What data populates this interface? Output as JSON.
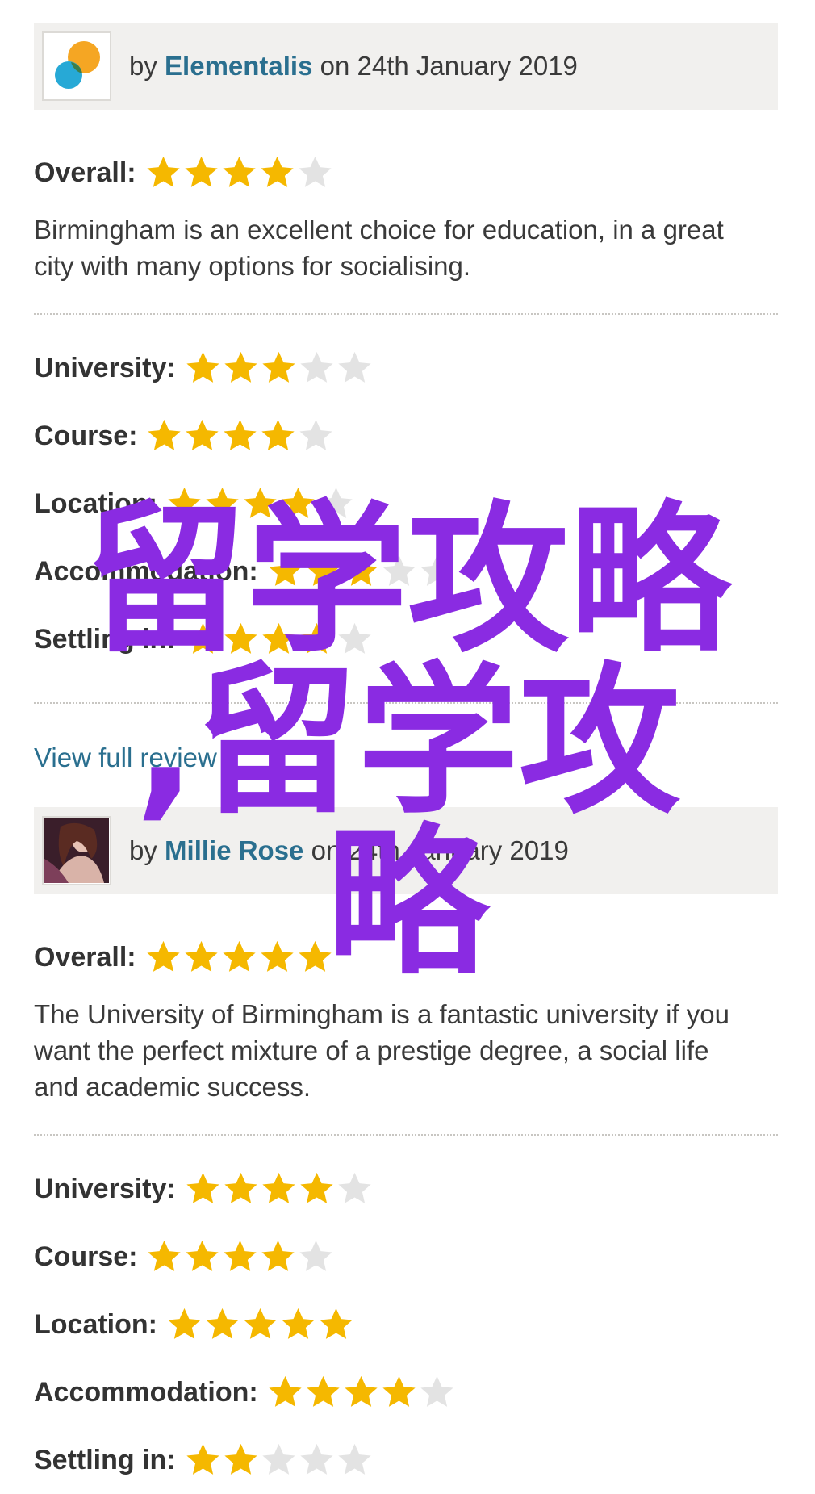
{
  "reviews": [
    {
      "by_prefix": "by",
      "author": "Elementalis",
      "date_text": "on 24th January 2019",
      "avatar_icon": "colored-bubbles-logo",
      "overall": {
        "label": "Overall:",
        "stars": 4,
        "max": 5
      },
      "summary": "Birmingham is an excellent choice for education, in a great city with many options for socialising.",
      "ratings": [
        {
          "label": "University:",
          "stars": 3,
          "max": 5
        },
        {
          "label": "Course:",
          "stars": 4,
          "max": 5
        },
        {
          "label": "Location:",
          "stars": 4,
          "max": 5
        },
        {
          "label": "Accommodation:",
          "stars": 3,
          "max": 5
        },
        {
          "label": "Settling in:",
          "stars": 4,
          "max": 5
        }
      ],
      "view_full_label": "View full review"
    },
    {
      "by_prefix": "by",
      "author": "Millie Rose",
      "date_text": "on 24th January 2019",
      "avatar_icon": "user-photo",
      "overall": {
        "label": "Overall:",
        "stars": 5,
        "max": 5
      },
      "summary": "The University of Birmingham is a fantastic university if you want the perfect mixture of a prestige degree, a social life and academic success.",
      "ratings": [
        {
          "label": "University:",
          "stars": 4,
          "max": 5
        },
        {
          "label": "Course:",
          "stars": 4,
          "max": 5
        },
        {
          "label": "Location:",
          "stars": 5,
          "max": 5
        },
        {
          "label": "Accommodation:",
          "stars": 4,
          "max": 5
        },
        {
          "label": "Settling in:",
          "stars": 2,
          "max": 5
        }
      ]
    }
  ],
  "watermark": {
    "line1": "留学攻略",
    "line2": ",留学攻",
    "line3": "略"
  },
  "colors": {
    "star_filled": "#f5b800",
    "star_empty": "#e3e3e3",
    "link": "#2a6f8f",
    "header_bg": "#f1f0ee",
    "watermark": "#8a2be2"
  }
}
